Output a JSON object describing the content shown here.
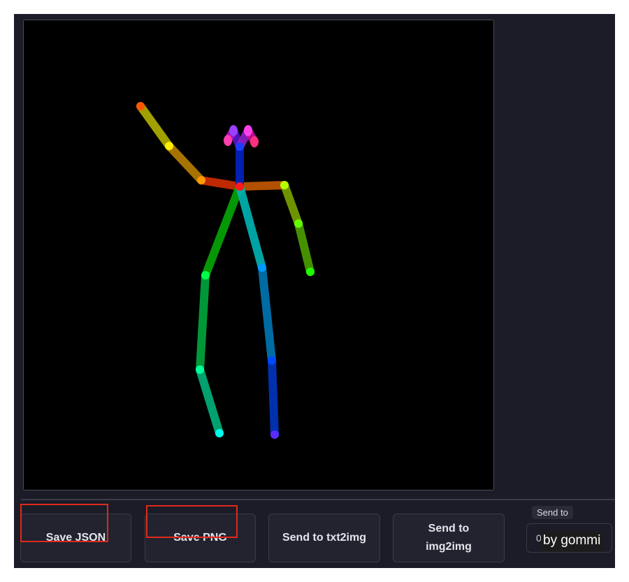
{
  "canvas": {
    "background": "#000000",
    "figure": "openpose-stick-skeleton"
  },
  "buttons": {
    "save_json": "Save JSON",
    "save_png": "Save PNG",
    "send_txt2img": "Send to txt2img",
    "send_img2img": "Send to img2img"
  },
  "send_to": {
    "label": "Send to",
    "value": "0"
  },
  "watermark": "by gommi",
  "colors": {
    "panel_bg": "#1b1c27",
    "button_bg": "#22232f",
    "highlight": "#e0291c"
  }
}
